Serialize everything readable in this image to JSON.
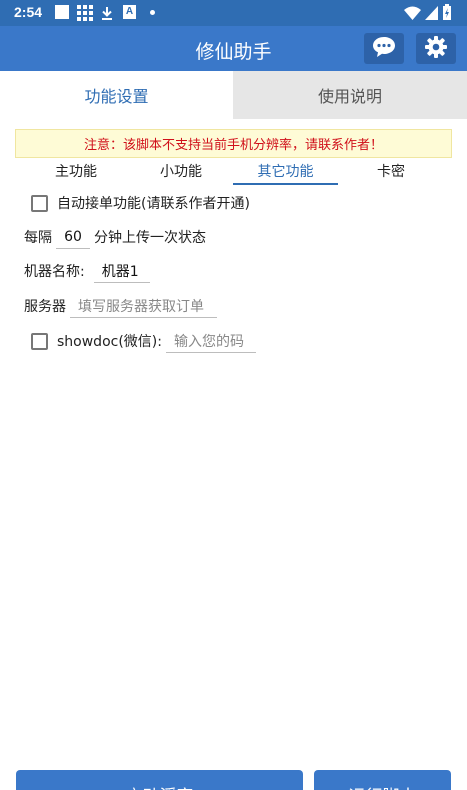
{
  "status_bar": {
    "time": "2:54",
    "a_glyph": "A"
  },
  "app_bar": {
    "title": "修仙助手",
    "chat_icon": "chat-bubble-icon",
    "settings_icon": "gear-icon"
  },
  "tabs": [
    {
      "label": "功能设置",
      "active": true
    },
    {
      "label": "使用说明",
      "active": false
    }
  ],
  "notice": "注意：该脚本不支持当前手机分辨率，请联系作者！",
  "sub_tabs": [
    {
      "label": "主功能"
    },
    {
      "label": "小功能"
    },
    {
      "label": "其它功能",
      "active": true
    },
    {
      "label": "卡密"
    }
  ],
  "auto_order": {
    "label": "自动接单功能(请联系作者开通)",
    "checked": false
  },
  "upload": {
    "prefix": "每隔",
    "value": "60",
    "suffix": "分钟上传一次状态"
  },
  "machine": {
    "label": "机器名称:",
    "value": "机器1"
  },
  "server": {
    "label": "服务器",
    "placeholder": "填写服务器获取订单"
  },
  "showdoc": {
    "label": "showdoc(微信):",
    "placeholder": "输入您的码",
    "checked": false
  },
  "bottom_buttons": [
    {
      "label": "启动浮窗"
    },
    {
      "label": "运行脚本"
    }
  ]
}
